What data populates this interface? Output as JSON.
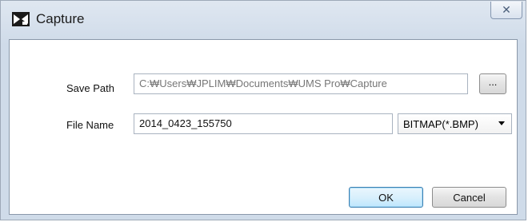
{
  "window": {
    "title": "Capture",
    "close_glyph": "✕",
    "icon": "capture-app-icon"
  },
  "form": {
    "save_path": {
      "label": "Save Path",
      "value": "C:₩Users₩JPLIM₩Documents₩UMS Pro₩Capture"
    },
    "browse_label": "...",
    "file_name": {
      "label": "File Name",
      "value": "2014_0423_155750"
    },
    "format": {
      "selected": "BITMAP(*.BMP)"
    }
  },
  "buttons": {
    "ok": "OK",
    "cancel": "Cancel"
  },
  "colors": {
    "title_bg": "#dfe7f1",
    "default_button_border": "#3c7fb1"
  }
}
